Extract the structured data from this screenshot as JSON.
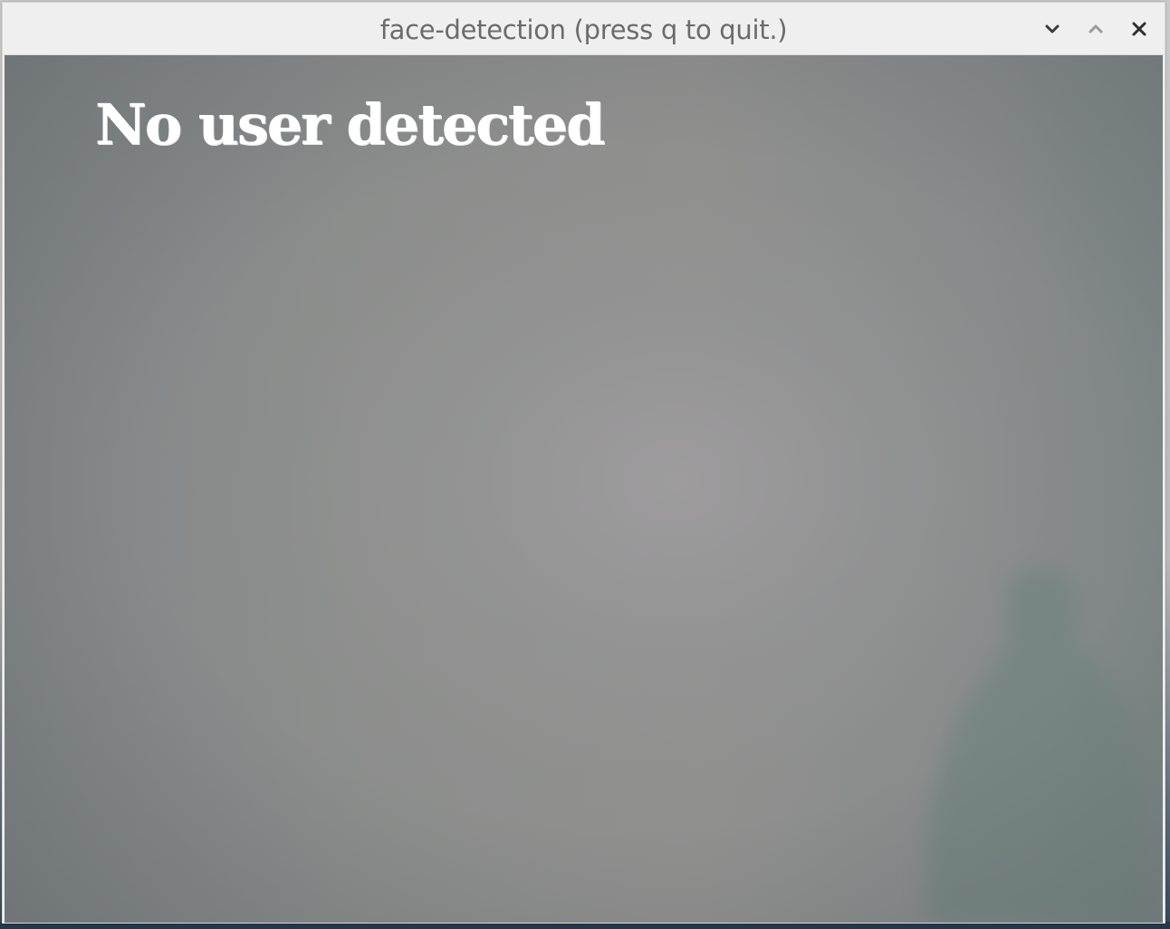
{
  "window": {
    "title": "face-detection (press q to quit.)",
    "controls": {
      "minimize_icon": "chevron-down-icon",
      "maximize_icon": "chevron-up-icon",
      "close_icon": "close-icon"
    }
  },
  "camera": {
    "overlay_text": "No user detected",
    "overlay_color": "#ffffff"
  }
}
